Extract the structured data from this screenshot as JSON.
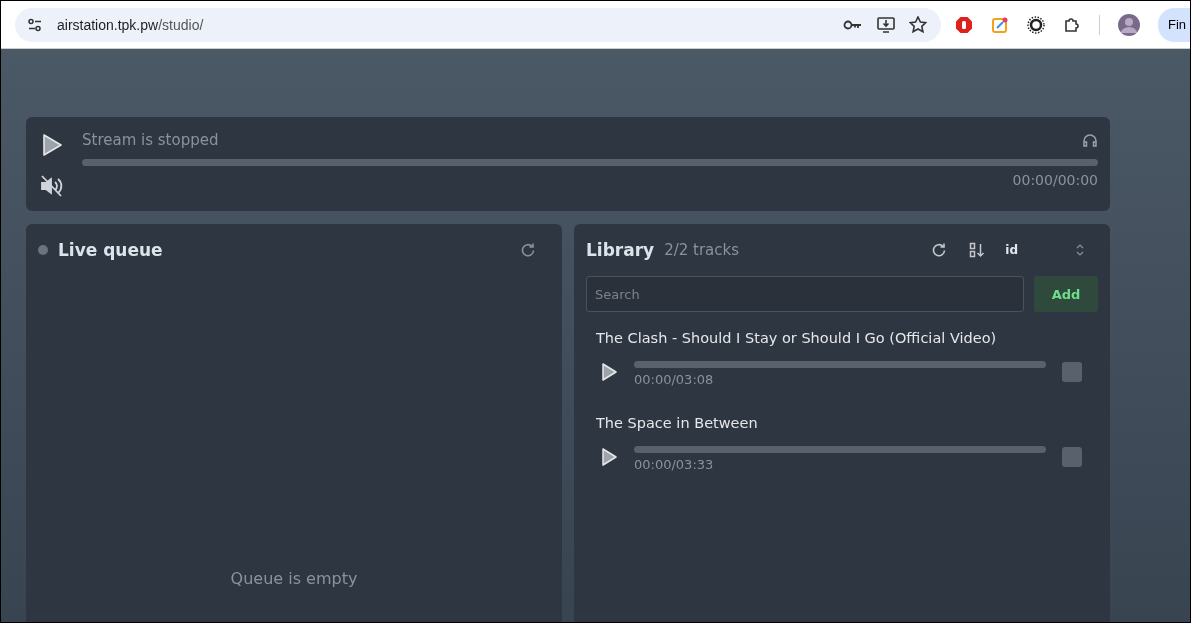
{
  "browser": {
    "url_host": "airstation.tpk.pw",
    "url_path": "/studio/",
    "profile_button": "Fin"
  },
  "player": {
    "status": "Stream is stopped",
    "muted": true,
    "level": 0,
    "time": "00:00/00:00"
  },
  "live_queue": {
    "title": "Live queue",
    "live": false,
    "empty_text": "Queue is empty"
  },
  "library": {
    "title": "Library",
    "count": "2/2 tracks",
    "sort_field": "id",
    "search": {
      "placeholder": "Search"
    },
    "add_button": "Add",
    "tracks": [
      {
        "title": "The Clash - Should I Stay or Should I Go (Official Video)",
        "level": 0,
        "time": "00:00/03:08",
        "checked": false
      },
      {
        "title": "The Space in Between",
        "level": 0,
        "time": "00:00/03:33",
        "checked": false
      }
    ]
  }
}
